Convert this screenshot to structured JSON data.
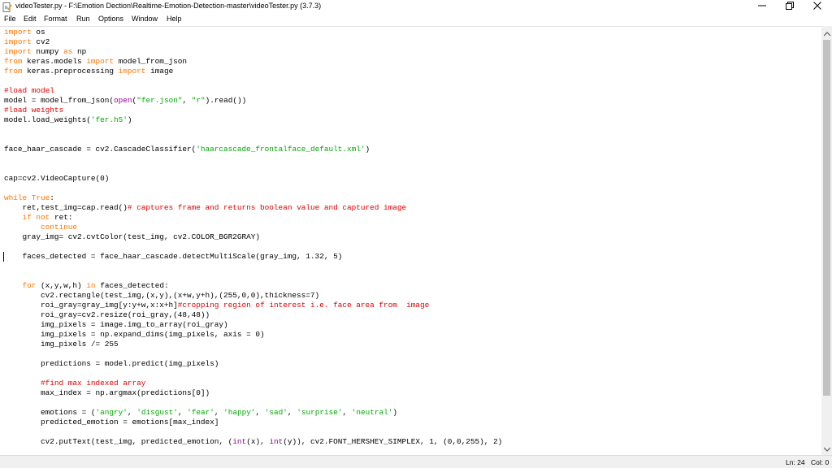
{
  "window": {
    "title": "videoTester.py - F:\\Emotion Dection\\Realtime-Emotion-Detection-master\\videoTester.py (3.7.3)"
  },
  "menu": [
    "File",
    "Edit",
    "Format",
    "Run",
    "Options",
    "Window",
    "Help"
  ],
  "code": {
    "l01": [
      "import",
      " os"
    ],
    "l02": [
      "import",
      " cv2"
    ],
    "l03": [
      "import",
      " numpy ",
      "as",
      " np"
    ],
    "l04": [
      "from",
      " keras.models ",
      "import",
      " model_from_json"
    ],
    "l05": [
      "from",
      " keras.preprocessing ",
      "import",
      " image"
    ],
    "l07": "#load model",
    "l08": [
      "model = model_from_json(",
      "open",
      "(",
      "\"fer.json\"",
      ", ",
      "\"r\"",
      ").read())"
    ],
    "l09": "#load weights",
    "l10": [
      "model.load_weights(",
      "'fer.h5'",
      ")"
    ],
    "l13": [
      "face_haar_cascade = cv2.CascadeClassifier(",
      "'haarcascade_frontalface_default.xml'",
      ")"
    ],
    "l16": "cap=cv2.VideoCapture(0)",
    "l18": [
      "while",
      " ",
      "True",
      ":"
    ],
    "l19": [
      "    ret,test_img=cap.read()",
      "# captures frame and returns boolean value and captured image"
    ],
    "l20": [
      "    ",
      "if",
      " ",
      "not",
      " ret:"
    ],
    "l21": [
      "        ",
      "continue"
    ],
    "l22": "    gray_img= cv2.cvtColor(test_img, cv2.COLOR_BGR2GRAY)",
    "l24": "    faces_detected = face_haar_cascade.detectMultiScale(gray_img, 1.32, 5)",
    "l27": [
      "    ",
      "for",
      " (x,y,w,h) ",
      "in",
      " faces_detected:"
    ],
    "l28": "        cv2.rectangle(test_img,(x,y),(x+w,y+h),(255,0,0),thickness=7)",
    "l29": [
      "        roi_gray=gray_img[y:y+w,x:x+h]",
      "#cropping region of interest i.e. face area from  image"
    ],
    "l30": "        roi_gray=cv2.resize(roi_gray,(48,48))",
    "l31": "        img_pixels = image.img_to_array(roi_gray)",
    "l32": "        img_pixels = np.expand_dims(img_pixels, axis = 0)",
    "l33": "        img_pixels /= 255",
    "l35": "        predictions = model.predict(img_pixels)",
    "l37": "        #find max indexed array",
    "l38": "        max_index = np.argmax(predictions[0])",
    "l40": [
      "        emotions = (",
      "'angry'",
      ", ",
      "'disgust'",
      ", ",
      "'fear'",
      ", ",
      "'happy'",
      ", ",
      "'sad'",
      ", ",
      "'surprise'",
      ", ",
      "'neutral'",
      ")"
    ],
    "l41": "        predicted_emotion = emotions[max_index]",
    "l43": [
      "        cv2.putText(test_img, predicted_emotion, (",
      "int",
      "(x), ",
      "int",
      "(y)), cv2.FONT_HERSHEY_SIMPLEX, 1, (0,0,255), 2)"
    ]
  },
  "status": {
    "line": "Ln: 24",
    "col": "Col: 0"
  }
}
